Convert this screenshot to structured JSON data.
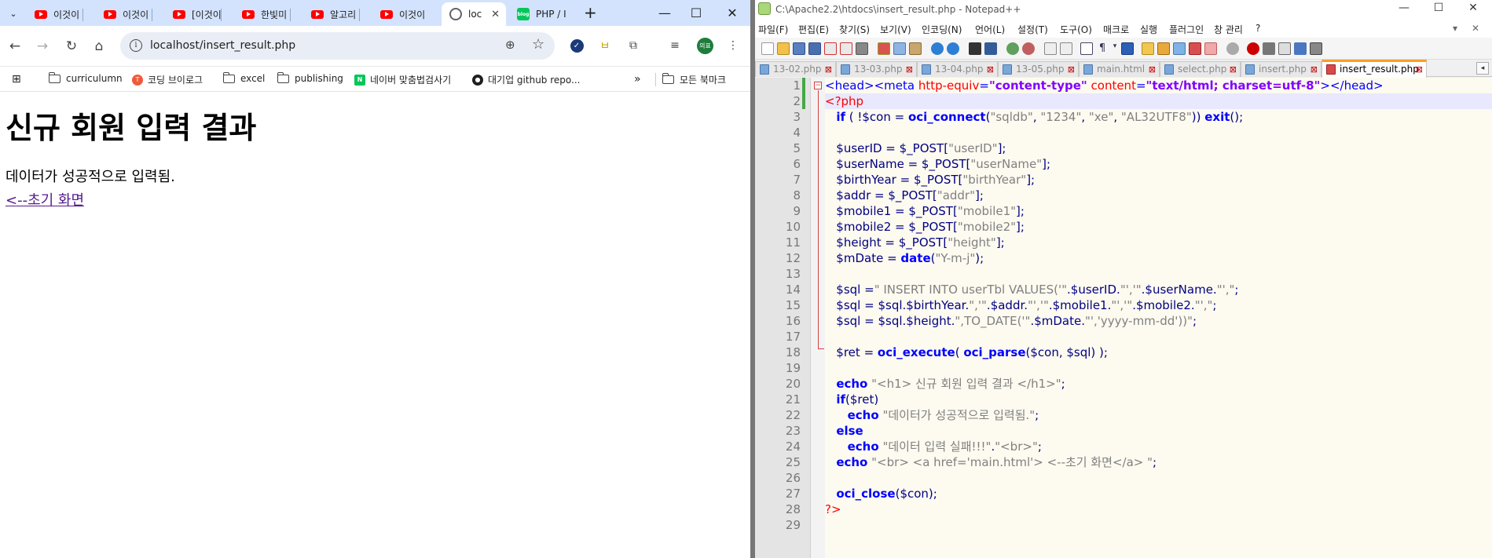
{
  "chrome": {
    "tabs": [
      {
        "title": "이것이"
      },
      {
        "title": "이것이"
      },
      {
        "title": "[이것이"
      },
      {
        "title": "한빛미"
      },
      {
        "title": "알고리"
      },
      {
        "title": "이것이"
      },
      {
        "title": "loc"
      },
      {
        "title": "PHP / I"
      }
    ],
    "url": "localhost/insert_result.php",
    "profile_initials": "의표",
    "bookmarks": [
      {
        "label": "curriculumn",
        "icon": "folder-icon"
      },
      {
        "label": "코딩 브이로그",
        "icon": "tistory-icon"
      },
      {
        "label": "excel",
        "icon": "folder-icon"
      },
      {
        "label": "publishing",
        "icon": "folder-icon"
      },
      {
        "label": "네이버 맞춤법검사기",
        "icon": "naver-icon"
      },
      {
        "label": "대기업 github repo...",
        "icon": "github-icon"
      }
    ],
    "all_bookmarks_label": "모든 북마크",
    "overflow_glyph": "»"
  },
  "page": {
    "heading": "신규 회원 입력 결과",
    "message": "데이터가 성공적으로 입력됨.",
    "back_link": "<--초기 화면"
  },
  "npp": {
    "title": "C:\\Apache2.2\\htdocs\\insert_result.php - Notepad++",
    "menu": [
      "파일(F)",
      "편집(E)",
      "찾기(S)",
      "보기(V)",
      "인코딩(N)",
      "언어(L)",
      "설정(T)",
      "도구(O)",
      "매크로",
      "실행",
      "플러그인",
      "창 관리",
      "?"
    ],
    "tabs": [
      {
        "label": "13-02.php",
        "active": false
      },
      {
        "label": "13-03.php",
        "active": false
      },
      {
        "label": "13-04.php",
        "active": false
      },
      {
        "label": "13-05.php",
        "active": false
      },
      {
        "label": "main.html",
        "active": false
      },
      {
        "label": "select.php",
        "active": false
      },
      {
        "label": "insert.php",
        "active": false
      },
      {
        "label": "insert_result.php",
        "active": true
      }
    ],
    "line_numbers": [
      "1",
      "2",
      "3",
      "4",
      "5",
      "6",
      "7",
      "8",
      "9",
      "10",
      "11",
      "12",
      "13",
      "14",
      "15",
      "16",
      "17",
      "18",
      "19",
      "20",
      "21",
      "22",
      "23",
      "24",
      "25",
      "26",
      "27",
      "28",
      "29"
    ]
  },
  "colors": {
    "chrome_tabstrip": "#d3e3fd",
    "link_visited": "#551a8b",
    "npp_keyword": "#0000ff",
    "npp_string": "#808080",
    "npp_php_tag": "#ff0000"
  }
}
